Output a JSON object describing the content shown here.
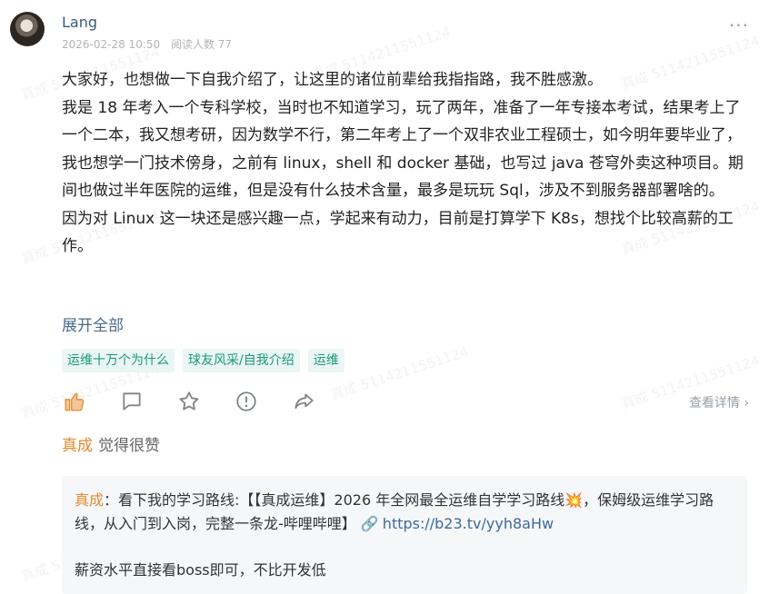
{
  "post": {
    "author": "Lang",
    "datetime": "2026-02-28 10:50",
    "read_label": "阅读人数 77",
    "content": [
      "大家好，也想做一下自我介绍了，让这里的诸位前辈给我指指路，我不胜感激。",
      "我是 18 年考入一个专科学校，当时也不知道学习，玩了两年，准备了一年专接本考试，结果考上了一个二本，我又想考研，因为数学不行，第二年考上了一个双非农业工程硕士，如今明年要毕业了，我也想学一门技术傍身，之前有 linux，shell 和 docker 基础，也写过 java 苍穹外卖这种项目。期间也做过半年医院的运维，但是没有什么技术含量，最多是玩玩 Sql，涉及不到服务器部署啥的。",
      "因为对 Linux 这一块还是感兴趣一点，学起来有动力，目前是打算学下 K8s，想找个比较高薪的工作。"
    ],
    "expand_label": "展开全部",
    "tags": [
      "运维十万个为什么",
      "球友风采/自我介绍",
      "运维"
    ],
    "view_detail": "查看详情",
    "likes": {
      "name": "真成",
      "text": "觉得很赞"
    }
  },
  "comment": {
    "name": "真成",
    "text": "：看下我的学习路线:【【真成运维】2026 年全网最全运维自学学习路线💥，保姆级运维学习路线，从入门到入岗，完整一条龙-哔哩哔哩】",
    "link": "https://b23.tv/yyh8aHw",
    "second": "薪资水平直接看boss即可，不比开发低"
  },
  "watermark": "真成 5114211551124",
  "icons": {
    "like": "thumbs-up-icon",
    "comment": "comment-icon",
    "favorite": "star-icon",
    "report": "alert-icon",
    "share": "share-icon",
    "more": "more-dots-icon",
    "link": "link-icon"
  },
  "colors": {
    "accent_orange": "#e48a2e",
    "tag_green": "#1b9a7a",
    "link_blue": "#3d6a9a"
  }
}
